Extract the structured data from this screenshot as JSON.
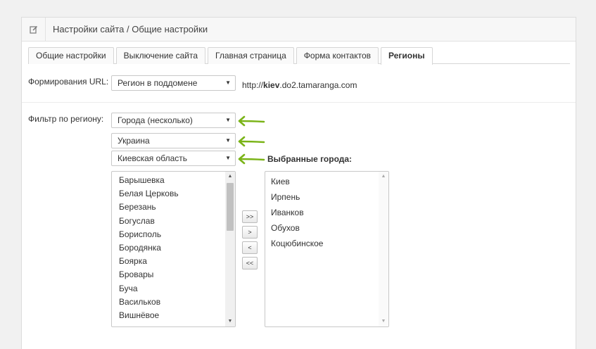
{
  "header": {
    "icon": "edit-icon",
    "title": "Настройки сайта / Общие настройки"
  },
  "tabs": [
    {
      "label": "Общие настройки",
      "active": false
    },
    {
      "label": "Выключение сайта",
      "active": false
    },
    {
      "label": "Главная страница",
      "active": false
    },
    {
      "label": "Форма контактов",
      "active": false
    },
    {
      "label": "Регионы",
      "active": true
    }
  ],
  "url": {
    "label": "Формирования URL:",
    "select_value": "Регион в поддомене",
    "example_prefix": "http://",
    "example_bold": "kiev",
    "example_suffix": ".do2.tamaranga.com"
  },
  "filter": {
    "label": "Фильтр по региону:",
    "type_value": "Города (несколько)",
    "country_value": "Украина",
    "region_value": "Киевская область",
    "arrow_color": "#7ab317"
  },
  "available_cities": [
    "Барышевка",
    "Белая Церковь",
    "Березань",
    "Богуслав",
    "Борисполь",
    "Бородянка",
    "Боярка",
    "Бровары",
    "Буча",
    "Васильков",
    "Вишнёвое"
  ],
  "move_buttons": {
    "add_all": ">>",
    "add": ">",
    "remove": "<",
    "remove_all": "<<"
  },
  "selected": {
    "title": "Выбранные города:",
    "cities": [
      "Киев",
      "Ирпень",
      "Иванков",
      "Обухов",
      "Коцюбинское"
    ]
  }
}
